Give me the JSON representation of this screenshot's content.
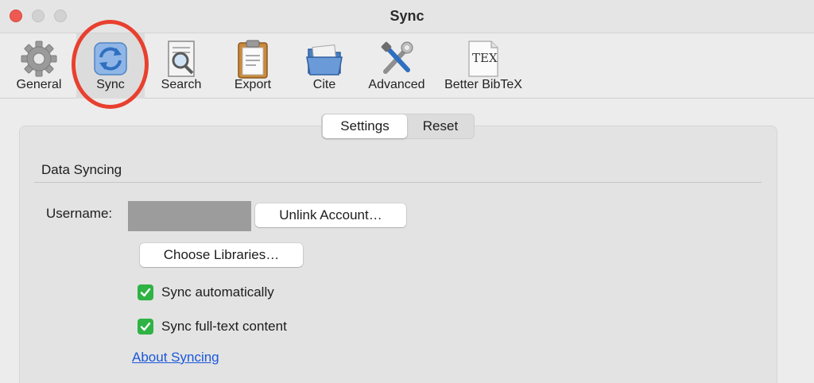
{
  "window": {
    "title": "Sync"
  },
  "toolbar": {
    "items": [
      {
        "label": "General",
        "icon": "gear-icon"
      },
      {
        "label": "Sync",
        "icon": "sync-icon"
      },
      {
        "label": "Search",
        "icon": "search-icon"
      },
      {
        "label": "Export",
        "icon": "clipboard-icon"
      },
      {
        "label": "Cite",
        "icon": "folder-icon"
      },
      {
        "label": "Advanced",
        "icon": "tools-icon"
      },
      {
        "label": "Better BibTeX",
        "icon": "tex-icon",
        "icon_text": "TEX"
      }
    ],
    "selected": "Sync",
    "highlight_color": "#e8402f"
  },
  "tabs": {
    "items": [
      "Settings",
      "Reset"
    ],
    "selected": "Settings"
  },
  "data_syncing": {
    "section_title": "Data Syncing",
    "username_label": "Username:",
    "unlink_button": "Unlink Account…",
    "choose_button": "Choose Libraries…",
    "sync_auto_label": "Sync automatically",
    "sync_auto_checked": true,
    "sync_fulltext_label": "Sync full-text content",
    "sync_fulltext_checked": true,
    "about_link": "About Syncing"
  },
  "colors": {
    "check_green": "#2fb344",
    "link_blue": "#1a57d9",
    "close_red": "#ee5a52"
  }
}
